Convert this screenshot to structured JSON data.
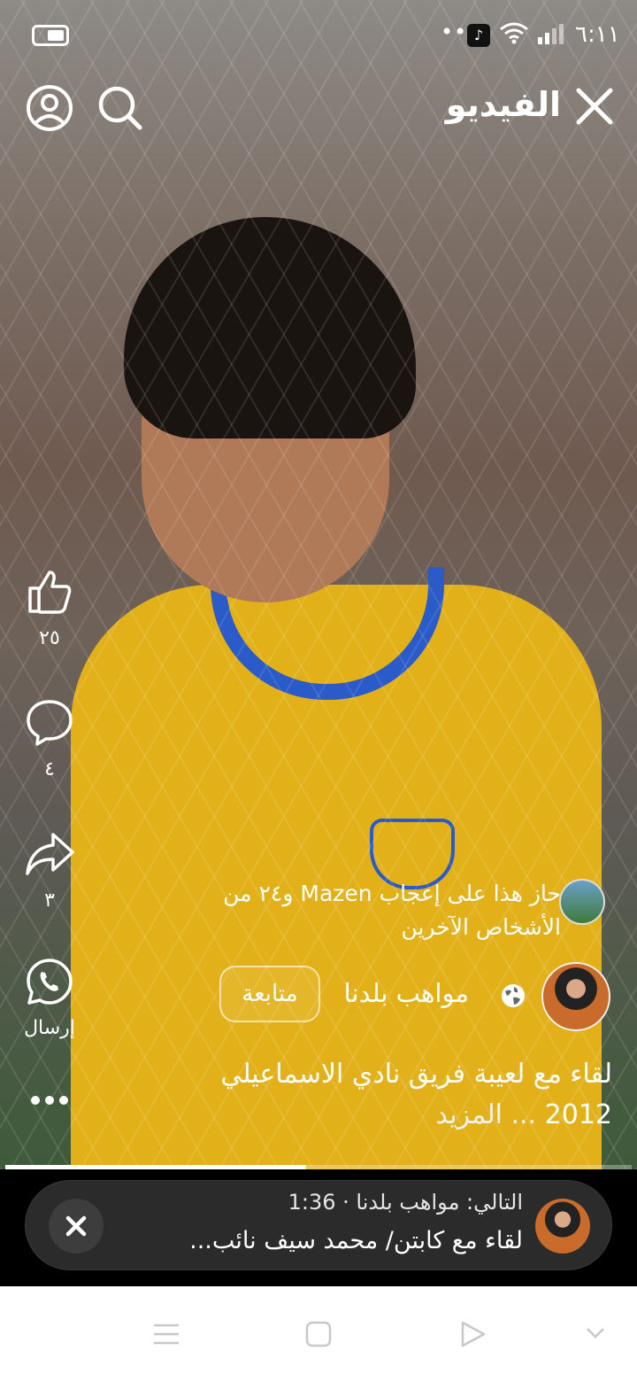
{
  "status_bar": {
    "time": "٦:١١",
    "dots": "•••"
  },
  "header": {
    "title": "الفيديو"
  },
  "actions": {
    "like_count": "٢٥",
    "comment_count": "٤",
    "share_count": "٣",
    "send_label": "إرسال"
  },
  "likes_summary": "حاز هذا على إعجاب Mazen و٢٤ من الأشخاص الآخرين",
  "page": {
    "name": "مواهب بلدنا",
    "follow_label": "متابعة"
  },
  "caption": {
    "text": "لقاء مع لعيبة فريق نادي الاسماعيلي 2012",
    "more": "... المزيد"
  },
  "progress": {
    "played_fraction": 0.48
  },
  "next_up": {
    "line1": "التالي: مواهب بلدنا · 1:36",
    "title": "لقاء مع كابتن/ محمد سيف نائب..."
  },
  "colors": {
    "shirt": "#e2b11a",
    "collar": "#2a5bc8"
  }
}
